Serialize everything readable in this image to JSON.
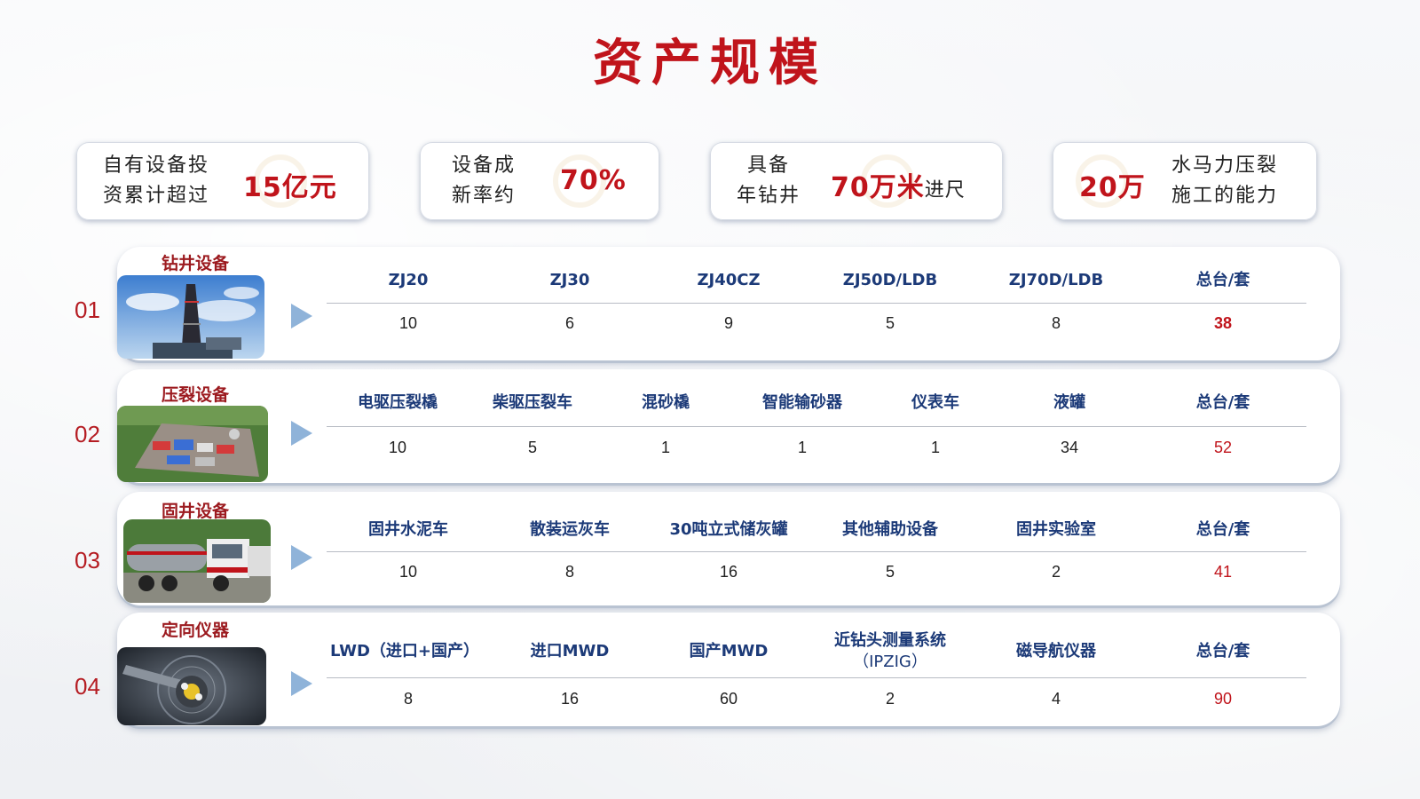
{
  "title": "资产规模",
  "stats": [
    {
      "label_line1": "自有设备投",
      "label_line2": "资累计超过",
      "value": "15亿元"
    },
    {
      "label_line1": "设备成",
      "label_line2": "新率约",
      "value": "70%"
    },
    {
      "label_line1": "具备",
      "label_line2": "年钻井",
      "value": "70万米",
      "suffix": "进尺"
    },
    {
      "value": "20万",
      "label_line1": "水马力压裂",
      "label_line2": "施工的能力"
    }
  ],
  "sections": [
    {
      "number": "01",
      "category": "钻井设备",
      "headers": [
        "ZJ20",
        "ZJ30",
        "ZJ40CZ",
        "ZJ50D/LDB",
        "ZJ70D/LDB",
        "总台/套"
      ],
      "values": [
        "10",
        "6",
        "9",
        "5",
        "8",
        "38"
      ]
    },
    {
      "number": "02",
      "category": "压裂设备",
      "headers": [
        "电驱压裂橇",
        "柴驱压裂车",
        "混砂橇",
        "智能输砂器",
        "仪表车",
        "液罐",
        "总台/套"
      ],
      "values": [
        "10",
        "5",
        "1",
        "1",
        "1",
        "34",
        "52"
      ]
    },
    {
      "number": "03",
      "category": "固井设备",
      "headers": [
        "固井水泥车",
        "散装运灰车",
        "30吨立式储灰罐",
        "其他辅助设备",
        "固井实验室",
        "总台/套"
      ],
      "values": [
        "10",
        "8",
        "16",
        "5",
        "2",
        "41"
      ]
    },
    {
      "number": "04",
      "category": "定向仪器",
      "headers": [
        "LWD（进口+国产）",
        "进口MWD",
        "国产MWD",
        "近钻头测量系统",
        "磁导航仪器",
        "总台/套"
      ],
      "header_sub": "（IPZIG）",
      "values": [
        "8",
        "16",
        "60",
        "2",
        "4",
        "90"
      ]
    }
  ]
}
